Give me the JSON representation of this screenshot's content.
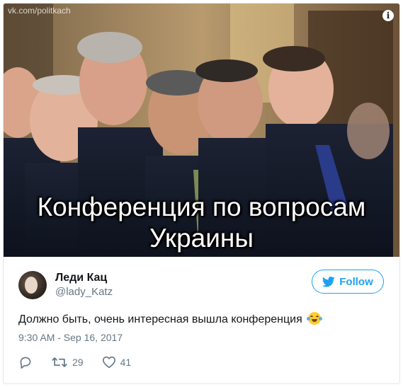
{
  "photo": {
    "watermark": "vk.com/politkach",
    "caption_line1": "Конференция по вопросам",
    "caption_line2": "Украины"
  },
  "author": {
    "name": "Леди Кац",
    "handle": "@lady_Katz"
  },
  "follow_button": {
    "label": "Follow"
  },
  "tweet": {
    "text": "Должно быть, очень интересная вышла конференция",
    "timestamp": "9:30 AM - Sep 16, 2017"
  },
  "actions": {
    "retweets": "29",
    "likes": "41"
  },
  "colors": {
    "accent": "#1da1f2",
    "secondary_text": "#657786",
    "primary_text": "#14171a"
  }
}
